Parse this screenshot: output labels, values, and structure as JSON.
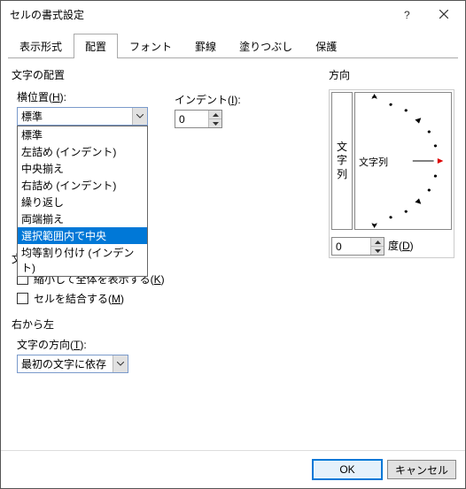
{
  "title": "セルの書式設定",
  "tabs": [
    "表示形式",
    "配置",
    "フォント",
    "罫線",
    "塗りつぶし",
    "保護"
  ],
  "active_tab": 1,
  "alignment": {
    "group_label": "文字の配置",
    "h_label_pre": "横位置(",
    "h_label_key": "H",
    "h_label_post": "):",
    "h_value": "標準",
    "h_options": [
      "標準",
      "左詰め (インデント)",
      "中央揃え",
      "右詰め (インデント)",
      "繰り返し",
      "両端揃え",
      "選択範囲内で中央",
      "均等割り付け (インデント)"
    ],
    "h_selected_index": 6,
    "indent_label_pre": "インデント(",
    "indent_label_key": "I",
    "indent_label_post": "):",
    "indent_value": "0"
  },
  "textctl": {
    "group_label": "文",
    "shrink_pre": "縮小して全体を表示する(",
    "shrink_key": "K",
    "shrink_post": ")",
    "merge_pre": "セルを結合する(",
    "merge_key": "M",
    "merge_post": ")"
  },
  "rtl": {
    "group_label": "右から左",
    "dir_label_pre": "文字の方向(",
    "dir_label_key": "T",
    "dir_label_post": "):",
    "dir_value": "最初の文字に依存"
  },
  "orient": {
    "group_label": "方向",
    "vertical_chars": [
      "文",
      "字",
      "列"
    ],
    "dial_label": "文字列",
    "degree_value": "0",
    "degree_label_pre": "度(",
    "degree_label_key": "D",
    "degree_label_post": ")"
  },
  "buttons": {
    "ok": "OK",
    "cancel": "キャンセル"
  }
}
